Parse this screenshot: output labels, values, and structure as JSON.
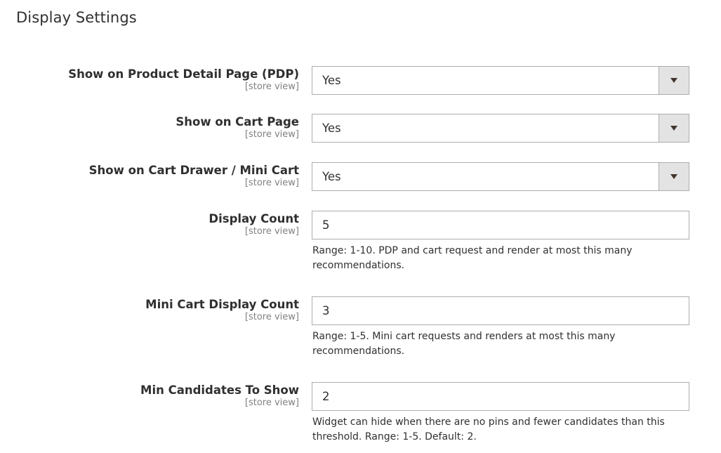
{
  "section": {
    "title": "Display Settings"
  },
  "fields": {
    "pdp": {
      "label": "Show on Product Detail Page (PDP)",
      "scope": "[store view]",
      "value": "Yes"
    },
    "cart": {
      "label": "Show on Cart Page",
      "scope": "[store view]",
      "value": "Yes"
    },
    "mini_cart": {
      "label": "Show on Cart Drawer / Mini Cart",
      "scope": "[store view]",
      "value": "Yes"
    },
    "display_count": {
      "label": "Display Count",
      "scope": "[store view]",
      "value": "5",
      "note": "Range: 1-10. PDP and cart request and render at most this many recommendations."
    },
    "mini_cart_display_count": {
      "label": "Mini Cart Display Count",
      "scope": "[store view]",
      "value": "3",
      "note": "Range: 1-5. Mini cart requests and renders at most this many recommendations."
    },
    "min_candidates": {
      "label": "Min Candidates To Show",
      "scope": "[store view]",
      "value": "2",
      "note": "Widget can hide when there are no pins and fewer candidates than this threshold. Range: 1-5. Default: 2."
    }
  },
  "icons": {
    "select_arrow": "triangle-down"
  },
  "colors": {
    "text": "#303030",
    "scope": "#808080",
    "border": "#adadad",
    "select_button_bg": "#e3e3e3"
  }
}
